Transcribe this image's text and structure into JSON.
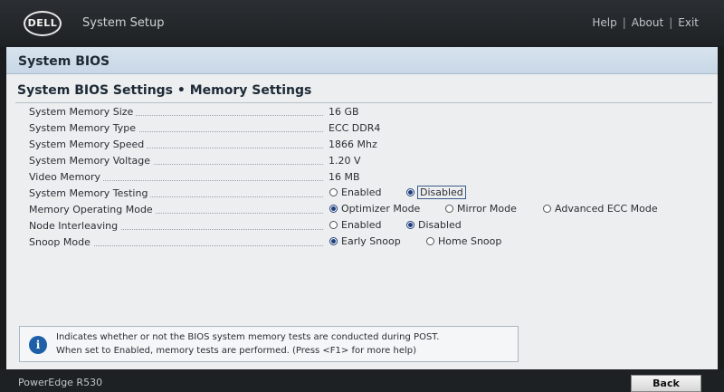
{
  "header": {
    "logo_text": "DELL",
    "app_title": "System Setup",
    "links": [
      "Help",
      "About",
      "Exit"
    ],
    "separator": "|"
  },
  "panel": {
    "title": "System BIOS",
    "section_title": "System BIOS Settings • Memory Settings"
  },
  "settings": {
    "memory_size": {
      "label": "System Memory Size",
      "value": "16 GB"
    },
    "memory_type": {
      "label": "System Memory Type",
      "value": "ECC DDR4"
    },
    "memory_speed": {
      "label": "System Memory Speed",
      "value": "1866 Mhz"
    },
    "memory_voltage": {
      "label": "System Memory Voltage",
      "value": "1.20 V"
    },
    "video_memory": {
      "label": "Video Memory",
      "value": "16 MB"
    },
    "memory_testing": {
      "label": "System Memory Testing",
      "options": [
        "Enabled",
        "Disabled"
      ],
      "selected": "Disabled"
    },
    "operating_mode": {
      "label": "Memory Operating Mode",
      "options": [
        "Optimizer Mode",
        "Mirror Mode",
        "Advanced ECC Mode"
      ],
      "selected": "Optimizer Mode"
    },
    "node_interleaving": {
      "label": "Node Interleaving",
      "options": [
        "Enabled",
        "Disabled"
      ],
      "selected": "Disabled"
    },
    "snoop_mode": {
      "label": "Snoop Mode",
      "options": [
        "Early Snoop",
        "Home Snoop"
      ],
      "selected": "Early Snoop"
    }
  },
  "help": {
    "icon": "info-icon",
    "line1": "Indicates whether or not the BIOS system memory tests are conducted during POST.",
    "line2": "When set to Enabled, memory tests are performed. (Press <F1> for more help)"
  },
  "footer": {
    "model": "PowerEdge R530",
    "back_label": "Back"
  },
  "colors": {
    "accent": "#1f3f7a",
    "panel_bg": "#eceef0",
    "header_bg": "#c8d7e6"
  }
}
